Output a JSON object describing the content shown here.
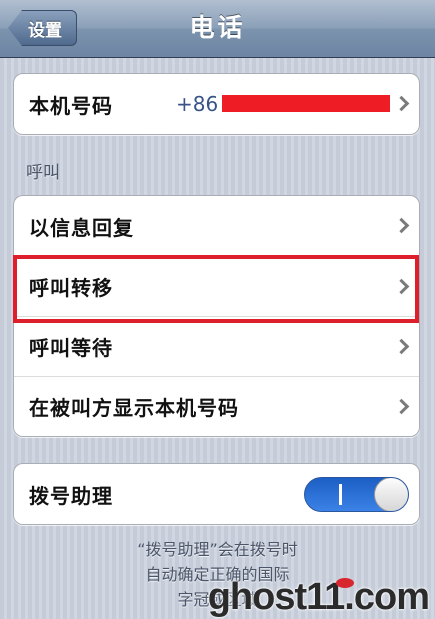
{
  "navbar": {
    "back_label": "设置",
    "title": "电话"
  },
  "my_number": {
    "label": "本机号码",
    "value": "+86"
  },
  "section_title": "呼叫",
  "call_items": [
    {
      "label": "以信息回复"
    },
    {
      "label": "呼叫转移"
    },
    {
      "label": "呼叫等待"
    },
    {
      "label": "在被叫方显示本机号码"
    }
  ],
  "dial_assist": {
    "label": "拨号助理",
    "enabled": true
  },
  "footer_lines": [
    "“拨号助理”会在拨号时",
    "自动确定正确的国际",
    "字冠或区域"
  ],
  "watermark": "ghost11.com",
  "colors": {
    "highlight": "#dc1f2a",
    "redaction": "#ee1c24",
    "toggle_on": "#2e6fd8",
    "value_text": "#385487"
  }
}
